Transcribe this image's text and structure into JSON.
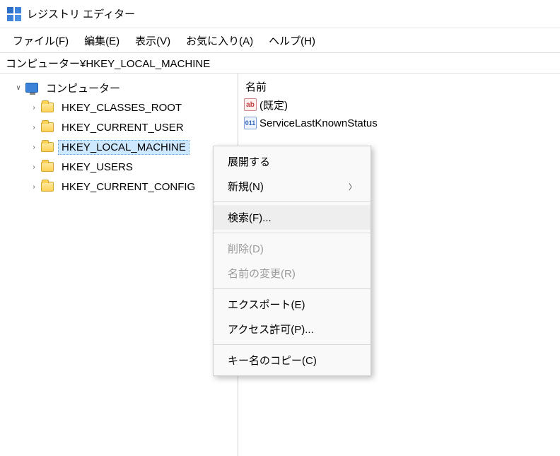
{
  "window": {
    "title": "レジストリ エディター"
  },
  "menubar": {
    "file": "ファイル(F)",
    "edit": "編集(E)",
    "view": "表示(V)",
    "favorites": "お気に入り(A)",
    "help": "ヘルプ(H)"
  },
  "address": {
    "path": "コンピューター¥HKEY_LOCAL_MACHINE"
  },
  "tree": {
    "root": "コンピューター",
    "items": [
      {
        "label": "HKEY_CLASSES_ROOT"
      },
      {
        "label": "HKEY_CURRENT_USER"
      },
      {
        "label": "HKEY_LOCAL_MACHINE",
        "selected": true
      },
      {
        "label": "HKEY_USERS"
      },
      {
        "label": "HKEY_CURRENT_CONFIG"
      }
    ]
  },
  "list": {
    "header_name": "名前",
    "rows": [
      {
        "icon": "string",
        "label": "(既定)"
      },
      {
        "icon": "binary",
        "label": "ServiceLastKnownStatus"
      }
    ]
  },
  "context_menu": {
    "expand": "展開する",
    "new": "新規(N)",
    "find": "検索(F)...",
    "delete": "削除(D)",
    "rename": "名前の変更(R)",
    "export": "エクスポート(E)",
    "permissions": "アクセス許可(P)...",
    "copy_key_name": "キー名のコピー(C)"
  }
}
